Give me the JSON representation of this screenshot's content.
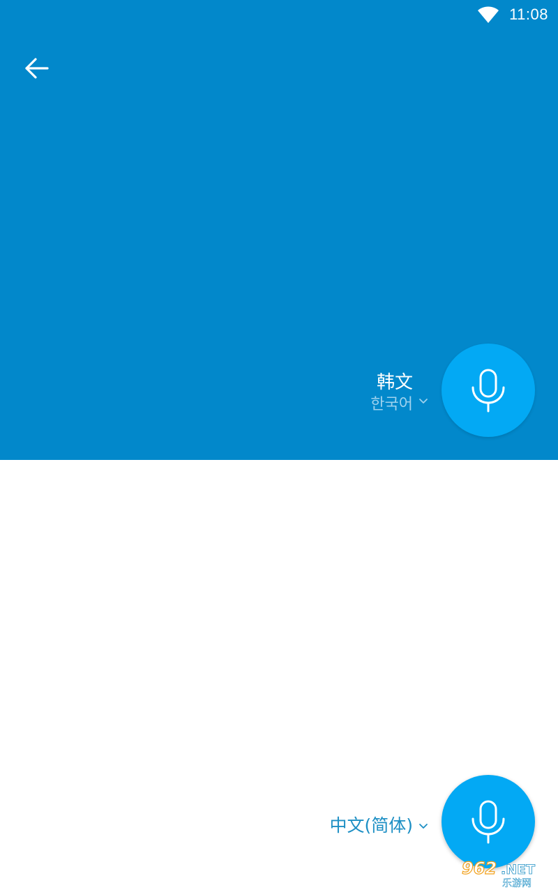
{
  "status_bar": {
    "time": "11:08",
    "wifi_icon": "wifi-icon"
  },
  "toolbar": {
    "back_icon": "arrow-left-icon"
  },
  "source": {
    "language_primary": "韩文",
    "language_native": "한국어",
    "chevron_icon": "chevron-down-icon",
    "mic_icon": "microphone-icon"
  },
  "target": {
    "language_primary": "中文(简体)",
    "chevron_icon": "chevron-down-icon",
    "mic_icon": "microphone-icon"
  },
  "watermark": {
    "text": "962.NET 乐游网"
  },
  "colors": {
    "top_pane": "#0288CB",
    "mic_button": "#03A9F4",
    "target_label": "#1D8FC4",
    "native_label": "#9FD2EE"
  }
}
